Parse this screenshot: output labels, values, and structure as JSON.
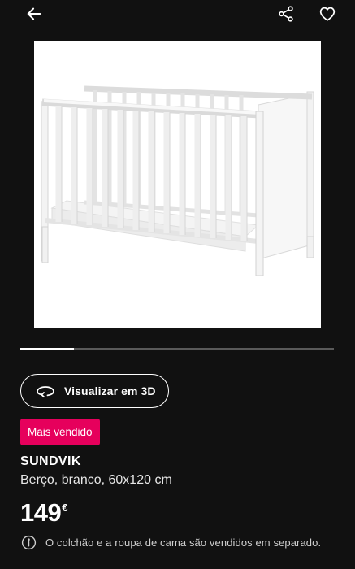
{
  "header": {
    "back_icon": "arrow-left-icon",
    "share_icon": "share-icon",
    "favorite_icon": "heart-outline-icon"
  },
  "gallery": {
    "image_alt": "SUNDVIK crib",
    "progress_fraction": 0.17
  },
  "actions": {
    "view_3d_label": "Visualizar em 3D",
    "view_3d_icon": "rotate-3d-icon"
  },
  "product": {
    "badge": "Mais vendido",
    "name": "SUNDVIK",
    "description": "Berço, branco, 60x120 cm",
    "price": "149",
    "currency": "€",
    "note": "O colchão e a roupa de cama são vendidos em separado.",
    "note_icon": "info-icon"
  },
  "colors": {
    "background": "#111111",
    "badge": "#e6005c",
    "text": "#ffffff"
  }
}
